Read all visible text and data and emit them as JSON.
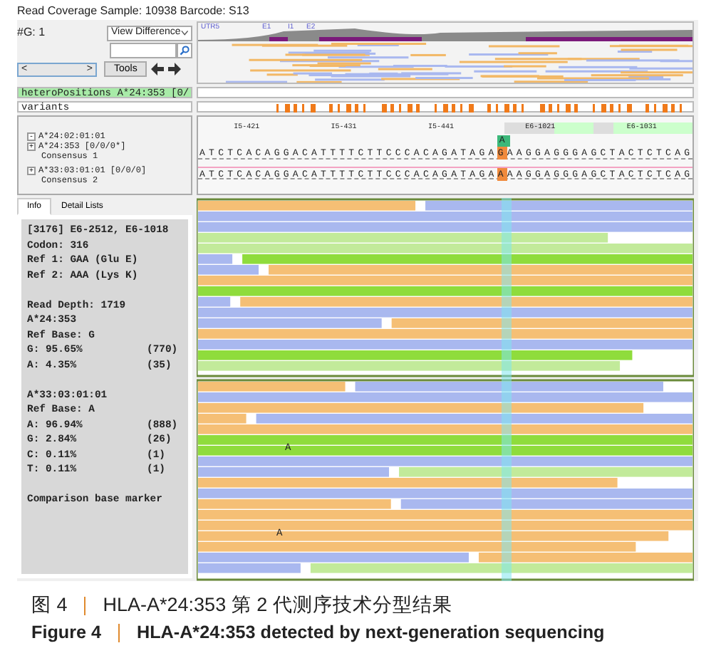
{
  "window": {
    "title": "Read Coverage Sample: 10938 Barcode: S13"
  },
  "toolbar": {
    "group_label": "#G: 1",
    "view_select": "View Difference",
    "scroll_left": "<",
    "scroll_right": ">",
    "tools_button": "Tools"
  },
  "coverage": {
    "labels": [
      "UTR5",
      "E1",
      "I1",
      "E2"
    ]
  },
  "tracks": [
    {
      "label": "heteroPositions A*24:353 [0/",
      "selected": true
    },
    {
      "label": "variants",
      "selected": false
    }
  ],
  "alleles": [
    {
      "kind": "allele",
      "toggle": "-",
      "name": "A*24:02:01:01"
    },
    {
      "kind": "allele",
      "toggle": "+",
      "name": "A*24:353 [0/0/0*]"
    },
    {
      "kind": "consensus",
      "name": "Consensus 1"
    },
    {
      "kind": "allele",
      "toggle": "+",
      "name": "A*33:03:01:01 [0/0/0]"
    },
    {
      "kind": "consensus",
      "name": "Consensus 2"
    }
  ],
  "sequence": {
    "positions": [
      "I5-421",
      "I5-431",
      "I5-441",
      "E6-1021",
      "E6-1031"
    ],
    "rows": [
      {
        "before": "ATCTCACAGGACATTTTCTTCCCACAGATAGA",
        "variant": "G",
        "after": "AAGGAGGGAGCTACTCTCAG",
        "alt_base": "A"
      },
      {
        "before": "ATCTCACAGGACATTTTCTTCCCACAGATAGA",
        "variant": "A",
        "after": "AAGGAGGGAGCTACTCTCAG"
      }
    ]
  },
  "info_tabs": [
    {
      "label": "Info",
      "selected": true
    },
    {
      "label": "Detail Lists",
      "selected": false
    }
  ],
  "info_blocks": [
    [
      {
        "text": "[3176] E6-2512, E6-1018"
      },
      {
        "text": "Codon: 316"
      },
      {
        "text": "Ref 1: GAA (Glu E)"
      },
      {
        "text": "Ref 2: AAA (Lys K)"
      }
    ],
    [
      {
        "text": "Read Depth: 1719"
      },
      {
        "text": "A*24:353"
      },
      {
        "text": "Ref Base: G"
      },
      {
        "text": "G: 95.65%",
        "count": "(770)"
      },
      {
        "text": "A: 4.35%",
        "count": "(35)"
      }
    ],
    [
      {
        "text": "A*33:03:01:01"
      },
      {
        "text": "Ref Base: A"
      },
      {
        "text": "A: 96.94%",
        "count": "(888)"
      },
      {
        "text": "G: 2.84%",
        "count": "(26)"
      },
      {
        "text": "C: 0.11%",
        "count": "(1)"
      },
      {
        "text": "T: 0.11%",
        "count": "(1)"
      }
    ],
    [
      {
        "text": "Comparison base marker"
      }
    ]
  ],
  "reads": {
    "marks": [
      "A",
      "A"
    ]
  },
  "caption": [
    {
      "label": "图 4",
      "text": "HLA-A*24:353 第 2 代测序技术分型结果"
    },
    {
      "label": "Figure 4",
      "text": "HLA-A*24:353 detected by next-generation sequencing"
    }
  ]
}
